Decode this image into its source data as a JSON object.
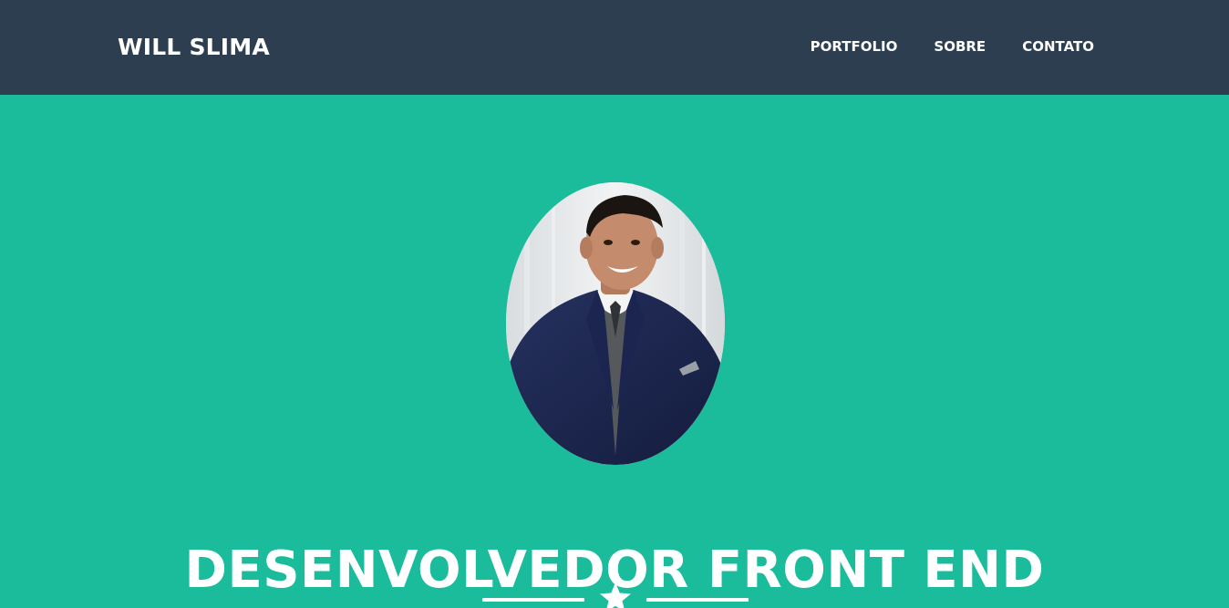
{
  "brand": {
    "name": "WILL SLIMA"
  },
  "nav": {
    "items": [
      {
        "label": "PORTFOLIO"
      },
      {
        "label": "SOBRE"
      },
      {
        "label": "CONTATO"
      }
    ]
  },
  "masthead": {
    "headline": "DESENVOLVEDOR FRONT END",
    "divider_icon": "star-icon"
  },
  "colors": {
    "navbar": "#2c3e50",
    "masthead": "#1abc9c",
    "text": "#ffffff"
  }
}
